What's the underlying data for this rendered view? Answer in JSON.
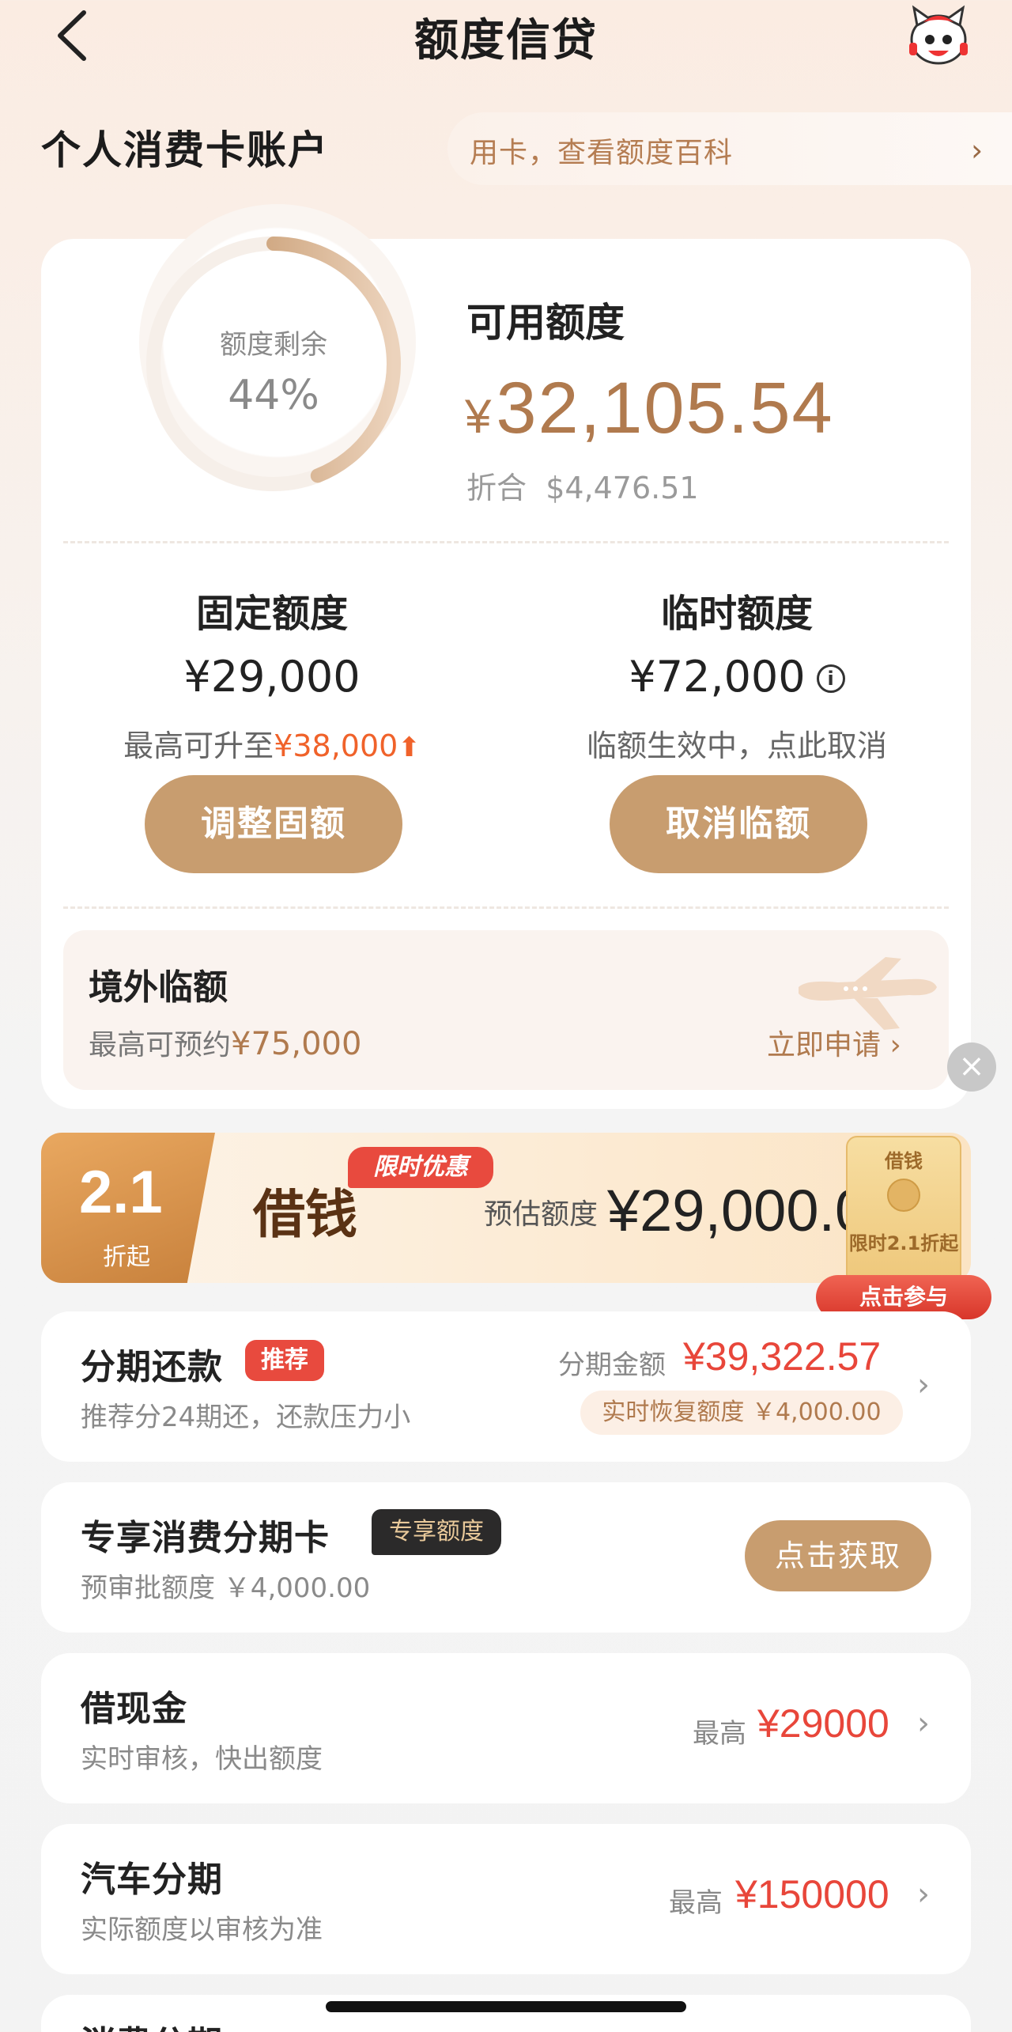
{
  "nav": {
    "title": "额度信贷",
    "back_icon": "back-arrow-icon",
    "avatar_icon": "mascot-icon"
  },
  "account": {
    "title": "个人消费卡账户",
    "tip_text": "用卡，查看额度百科",
    "tip_arrow": "›"
  },
  "summary": {
    "ring_label": "额度剩余",
    "ring_percent_text": "44%",
    "ring_percent": 0.44,
    "available_title": "可用额度",
    "available_currency": "¥",
    "available_amount": "32,105.54",
    "usd_label": "折合",
    "usd_amount": "$4,476.51"
  },
  "fixed": {
    "title": "固定额度",
    "amount": "¥29,000",
    "sub_prefix": "最高可升至",
    "sub_amount": "¥38,000",
    "button": "调整固额"
  },
  "temp": {
    "title": "临时额度",
    "amount": "¥72,000",
    "info": "i",
    "sub": "临额生效中，点此取消",
    "button": "取消临额"
  },
  "overseas": {
    "title": "境外临额",
    "sub_prefix": "最高可预约",
    "sub_amount": "¥75,000",
    "link": "立即申请 ›"
  },
  "promo": {
    "badge_num": "2.1",
    "badge_sub": "折起",
    "title": "借钱",
    "tag": "限时优惠",
    "est_label": "预估额度",
    "est_amount": "¥29,000.00",
    "envelope_top": "借钱",
    "envelope_bottom": "限时2.1折起",
    "join_button": "点击参与",
    "close": "×"
  },
  "installment": {
    "title": "分期还款",
    "tag": "推荐",
    "sub": "推荐分24期还，还款压力小",
    "amount_label": "分期金额",
    "amount": "¥39,322.57",
    "recover": "实时恢复额度 ￥4,000.00"
  },
  "vip_card": {
    "title": "专享消费分期卡",
    "tag": "专享额度",
    "sub": "预审批额度 ￥4,000.00",
    "button": "点击获取"
  },
  "cash": {
    "title": "借现金",
    "sub": "实时审核，快出额度",
    "label": "最高",
    "amount": "¥29000"
  },
  "car": {
    "title": "汽车分期",
    "sub": "实际额度以审核为准",
    "label": "最高",
    "amount": "¥150000"
  },
  "consume": {
    "title": "消费分期"
  },
  "colors": {
    "gold": "#c89d6f",
    "red": "#e8463a",
    "orange": "#f0622a"
  }
}
